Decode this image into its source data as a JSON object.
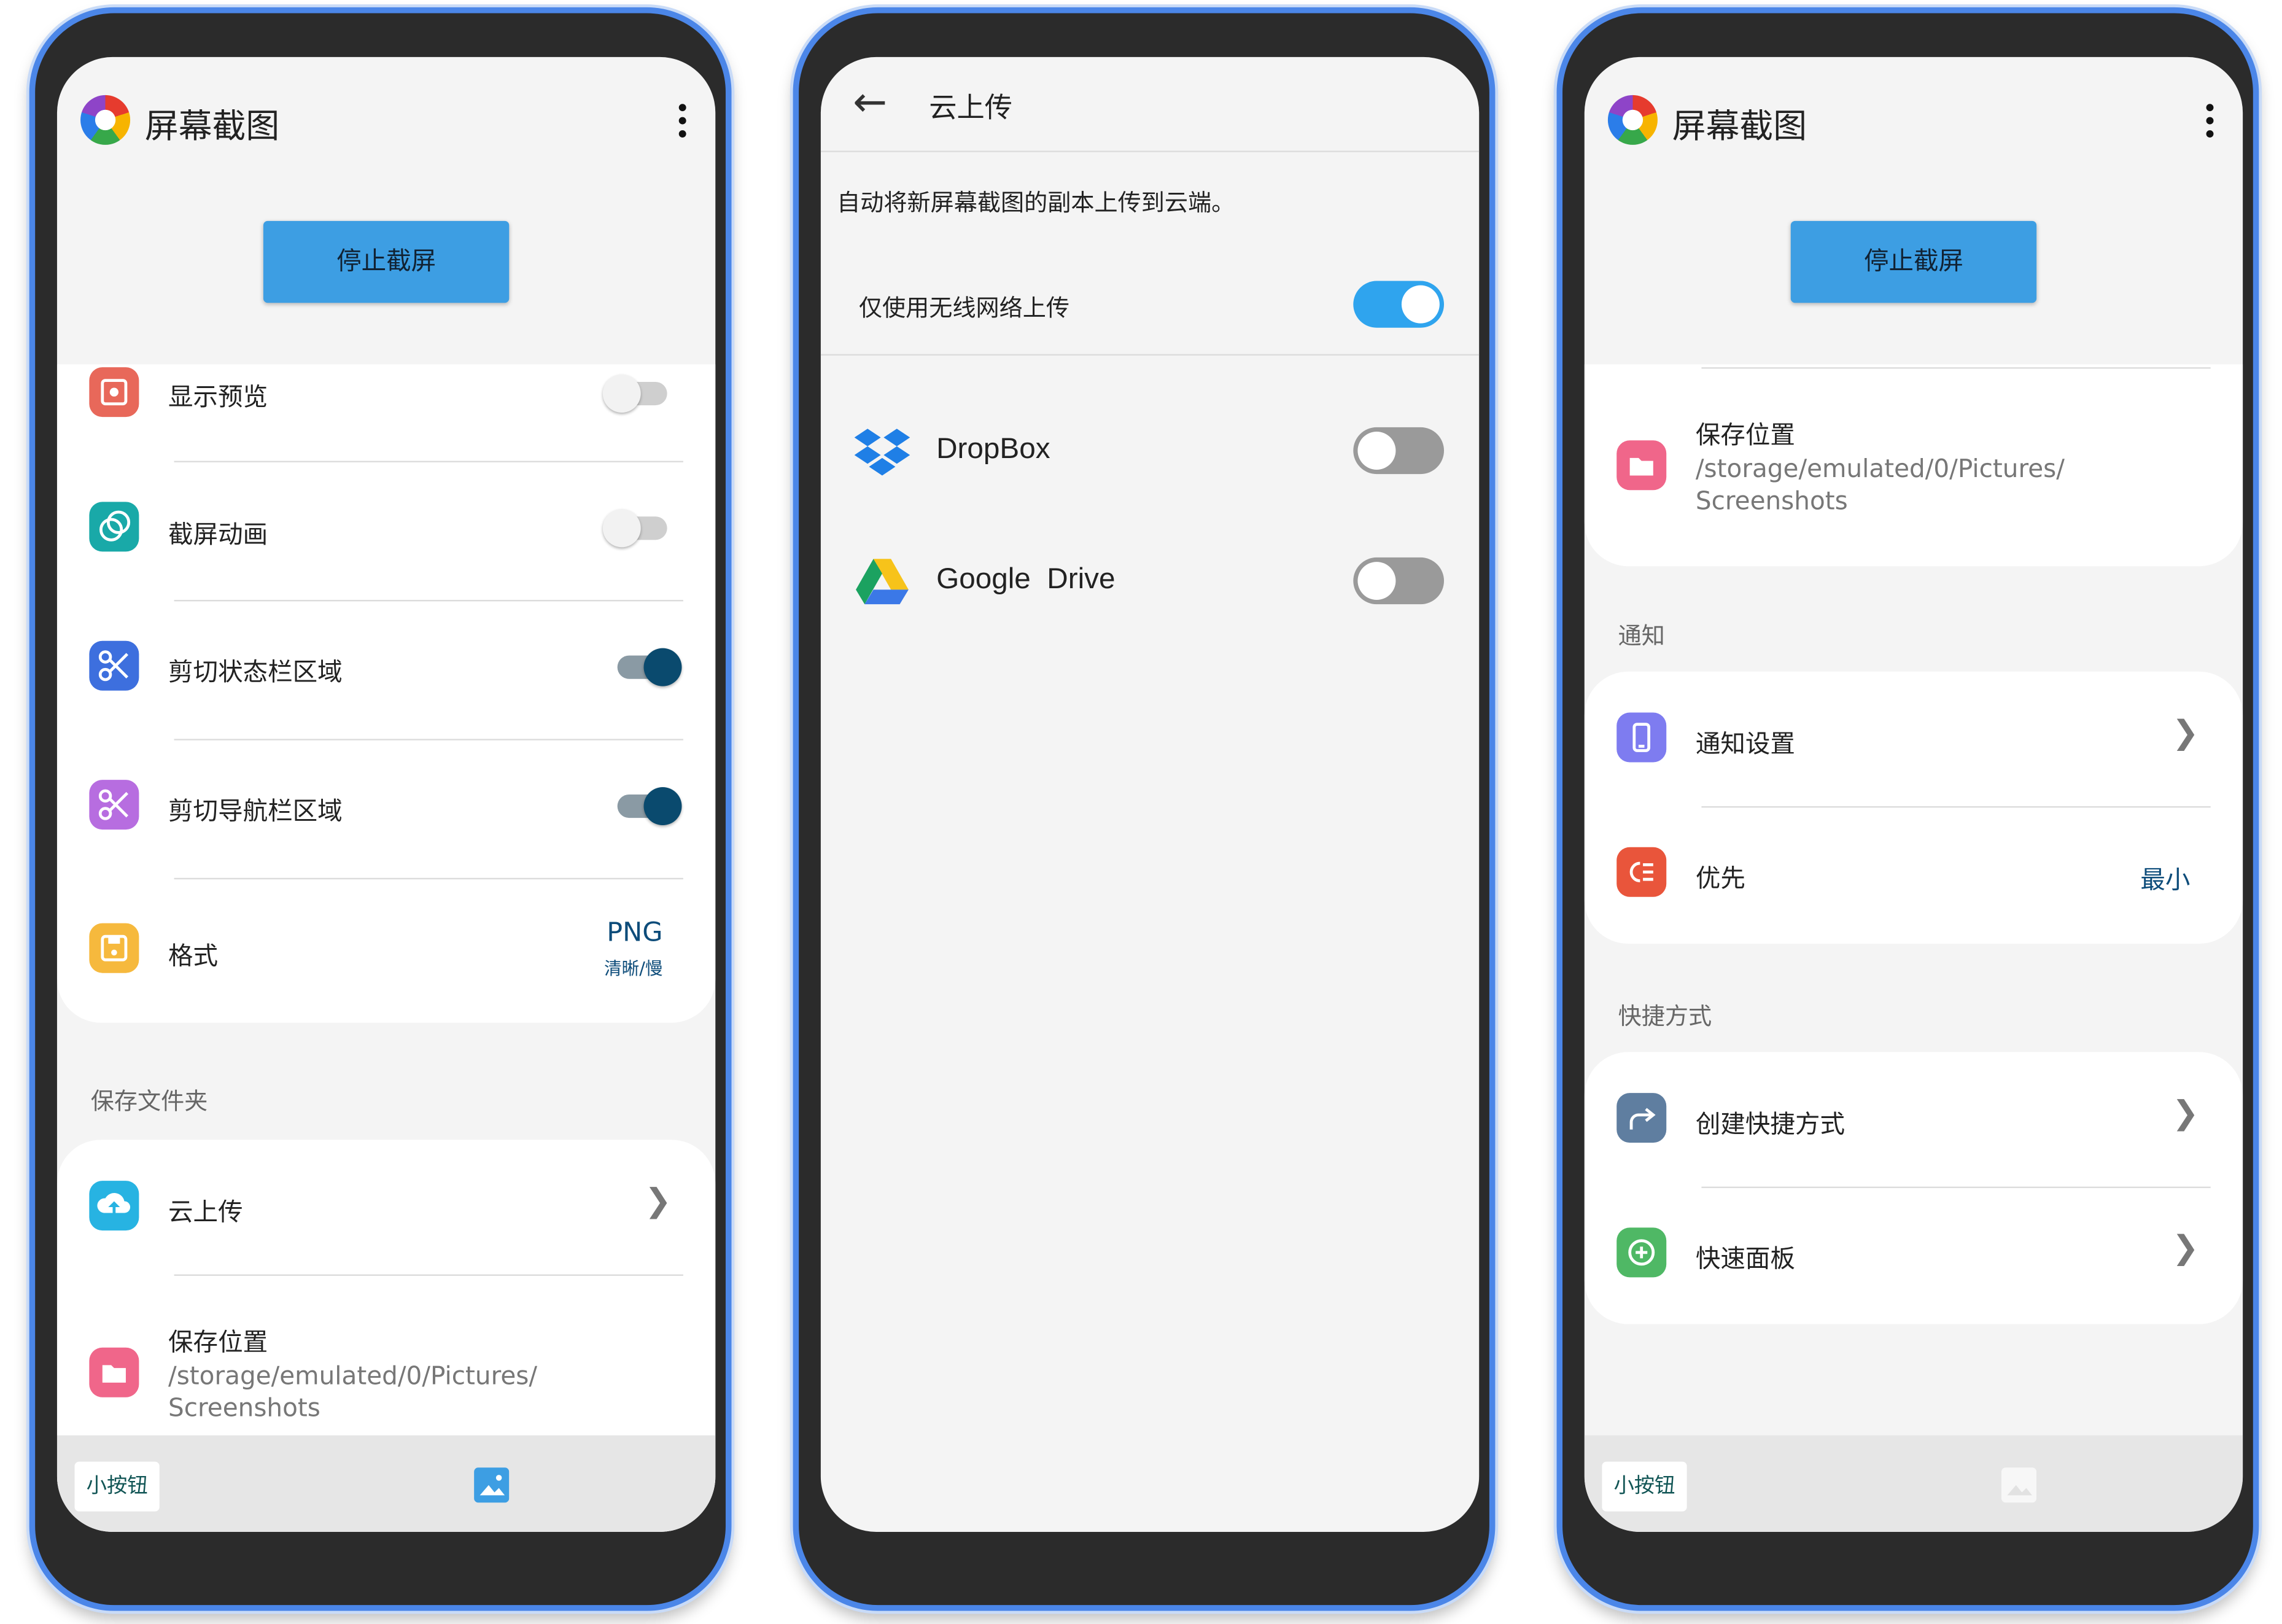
{
  "colors": {
    "frame": "#4b86e8",
    "primary_button": "#3d9ee3",
    "toggle_on_knob": "#0a4a6e",
    "link_value": "#0d4c7a"
  },
  "screen1": {
    "app_title": "屏幕截图",
    "stop_button": "停止截屏",
    "settings": [
      {
        "label": "显示预览",
        "icon": "eye-icon",
        "state": "off"
      },
      {
        "label": "截屏动画",
        "icon": "animation-icon",
        "state": "off"
      },
      {
        "label": "剪切状态栏区域",
        "icon": "scissors-icon",
        "state": "on"
      },
      {
        "label": "剪切导航栏区域",
        "icon": "scissors-icon",
        "state": "on"
      }
    ],
    "format": {
      "label": "格式",
      "value": "PNG",
      "note": "清晰/慢"
    },
    "save_section_title": "保存文件夹",
    "cloud_upload": {
      "label": "云上传"
    },
    "save_location": {
      "label": "保存位置",
      "path": "/storage/emulated/0/Pictures/ Screenshots"
    },
    "bottom": {
      "mini_button": "小按钮",
      "image_icon": "image-icon"
    }
  },
  "screen2": {
    "title": "云上传",
    "description": "自动将新屏幕截图的副本上传到云端。",
    "wifi_only": {
      "label": "仅使用无线网络上传",
      "state": "on"
    },
    "services": [
      {
        "name": "DropBox",
        "icon": "dropbox-icon",
        "state": "off"
      },
      {
        "name": "Google  Drive",
        "icon": "google-drive-icon",
        "state": "off"
      }
    ]
  },
  "screen3": {
    "app_title": "屏幕截图",
    "stop_button": "停止截屏",
    "save_location": {
      "label": "保存位置",
      "path": "/storage/emulated/0/Pictures/ Screenshots"
    },
    "notify_section_title": "通知",
    "notify_settings": {
      "label": "通知设置"
    },
    "priority": {
      "label": "优先",
      "value": "最小"
    },
    "shortcut_section_title": "快捷方式",
    "create_shortcut": {
      "label": "创建快捷方式"
    },
    "quick_panel": {
      "label": "快速面板"
    },
    "bottom": {
      "mini_button": "小按钮",
      "image_icon": "image-icon"
    }
  }
}
